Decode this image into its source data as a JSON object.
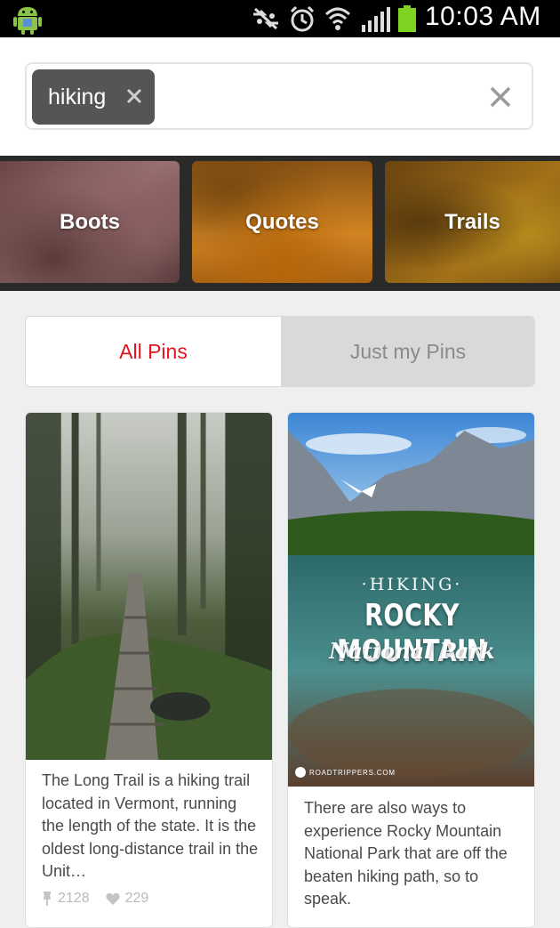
{
  "status_bar": {
    "time": "10:03 AM",
    "icons": [
      "android-debug-icon",
      "sync-off-icon",
      "alarm-icon",
      "wifi-icon",
      "signal-icon",
      "battery-icon"
    ],
    "battery_color": "#7ed321"
  },
  "search": {
    "chip_label": "hiking",
    "chip_remove_icon": "close-icon",
    "clear_icon": "close-icon"
  },
  "guides": [
    {
      "label": "Boots"
    },
    {
      "label": "Quotes"
    },
    {
      "label": "Trails"
    }
  ],
  "filter": {
    "all_label": "All Pins",
    "mine_label": "Just my Pins",
    "active": "All Pins",
    "active_color": "#e0141e"
  },
  "pins": [
    {
      "description": "The Long Trail is a hiking trail located in Vermont, running the length of the state. It is the oldest long-distance trail in the Unit…",
      "repins": "2128",
      "likes": "229",
      "image": "foggy-forest-boardwalk"
    },
    {
      "description": "There are also ways to experience Rocky Mountain National Park that are off the beaten hiking path, so to speak.",
      "image": "rocky-mountain-lake",
      "overlay": {
        "line1": "·HIKING·",
        "line2": "ROCKY MOUNTAIN",
        "line3": "National Park",
        "credit": "ROADTRIPPERS.COM"
      }
    }
  ]
}
